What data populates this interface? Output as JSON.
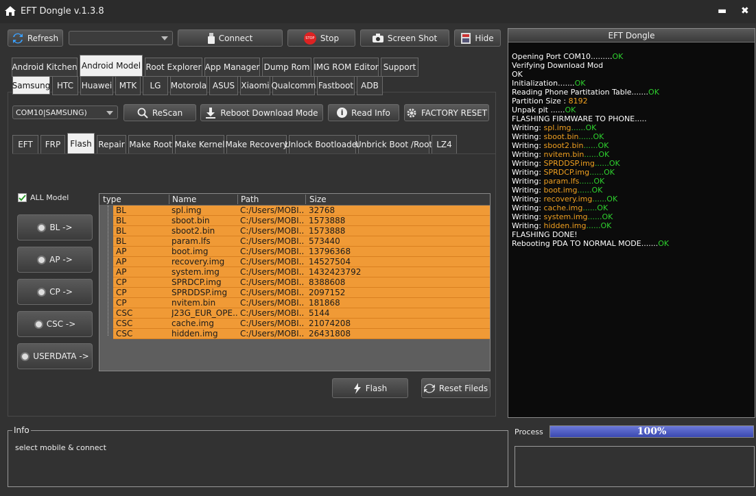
{
  "titlebar": {
    "title": "EFT Dongle  v.1.3.8",
    "minimize": "▬",
    "close": "✖"
  },
  "toolbar": {
    "refresh": "Refresh",
    "port_combo": "",
    "connect": "Connect",
    "stop": "Stop",
    "stop_badge": "STOP",
    "screenshot": "Screen Shot",
    "hide": "Hide"
  },
  "main_tabs": [
    "Android Kitchen",
    "Android Model",
    "Root Explorer",
    "App Manager",
    "Dump Rom",
    "IMG ROM Editor",
    "Support"
  ],
  "brand_tabs": [
    "Samsung",
    "HTC",
    "Huawei",
    "MTK",
    "LG",
    "Motorola",
    "ASUS",
    "Xiaomi",
    "Qualcomm",
    "Fastboot",
    "ADB"
  ],
  "device": {
    "port_select": "COM10|SAMSUNG)",
    "rescan": "ReScan",
    "reboot_download": "Reboot  Download Mode",
    "read_info": "Read Info",
    "factory_reset": "FACTORY RESET"
  },
  "func_tabs": [
    "EFT",
    "FRP",
    "Flash",
    "Repair",
    "Make Root",
    "Make Kernel",
    "Make Recovery",
    "Unlock Bootloader",
    "Unbrick Boot /Root",
    "LZ4"
  ],
  "all_model": "ALL Model",
  "side_buttons": [
    "BL ->",
    "AP ->",
    "CP ->",
    "CSC ->",
    "USERDATA ->"
  ],
  "grid": {
    "columns": [
      "type",
      "Name",
      "Path",
      "Size"
    ],
    "rows": [
      {
        "type": "BL",
        "name": "spl.img",
        "path": "C:/Users/MOBI...",
        "size": "32768"
      },
      {
        "type": "BL",
        "name": "sboot.bin",
        "path": "C:/Users/MOBI...",
        "size": "1573888"
      },
      {
        "type": "BL",
        "name": "sboot2.bin",
        "path": "C:/Users/MOBI...",
        "size": "1573888"
      },
      {
        "type": "BL",
        "name": "param.lfs",
        "path": "C:/Users/MOBI...",
        "size": "573440"
      },
      {
        "type": "AP",
        "name": "boot.img",
        "path": "C:/Users/MOBI...",
        "size": "13796368"
      },
      {
        "type": "AP",
        "name": "recovery.img",
        "path": "C:/Users/MOBI...",
        "size": "14527504"
      },
      {
        "type": "AP",
        "name": "system.img",
        "path": "C:/Users/MOBI...",
        "size": "1432423792"
      },
      {
        "type": "CP",
        "name": "SPRDCP.img",
        "path": "C:/Users/MOBI...",
        "size": "8388608"
      },
      {
        "type": "CP",
        "name": "SPRDDSP.img",
        "path": "C:/Users/MOBI...",
        "size": "2097152"
      },
      {
        "type": "CP",
        "name": "nvitem.bin",
        "path": "C:/Users/MOBI...",
        "size": "181868"
      },
      {
        "type": "CSC",
        "name": "J23G_EUR_OPE...",
        "path": "C:/Users/MOBI...",
        "size": "5144"
      },
      {
        "type": "CSC",
        "name": "cache.img",
        "path": "C:/Users/MOBI...",
        "size": "21074208"
      },
      {
        "type": "CSC",
        "name": "hidden.img",
        "path": "C:/Users/MOBI...",
        "size": "26431808"
      }
    ]
  },
  "actions": {
    "flash": "Flash",
    "reset": "Reset Fileds"
  },
  "log": {
    "title": "EFT Dongle",
    "lines": [
      {
        "text": "Opening Port COM10.........",
        "ok": "OK",
        "val": ""
      },
      {
        "text": "Verifying Download Mod",
        "ok": "",
        "val": ""
      },
      {
        "text": "OK",
        "ok": "",
        "val": ""
      },
      {
        "text": "Initialization.......",
        "ok": "OK",
        "val": ""
      },
      {
        "text": "Reading Phone Partitation Table.......",
        "ok": "OK",
        "val": ""
      },
      {
        "text": "Partition Size : ",
        "ok": "",
        "val": "8192"
      },
      {
        "text": "Unpak pit ......",
        "ok": "OK",
        "val": ""
      },
      {
        "text": "FLASHING FIRMWARE TO PHONE.....",
        "ok": "",
        "val": ""
      },
      {
        "text": "Writing: ",
        "val": "spl.img",
        "ok": "......OK"
      },
      {
        "text": "Writing: ",
        "val": "sboot.bin",
        "ok": "......OK"
      },
      {
        "text": "Writing: ",
        "val": "sboot2.bin",
        "ok": "......OK"
      },
      {
        "text": "Writing: ",
        "val": "nvitem.bin",
        "ok": "......OK"
      },
      {
        "text": "Writing: ",
        "val": "SPRDDSP.img",
        "ok": "......OK"
      },
      {
        "text": "Writing: ",
        "val": "SPRDCP.img",
        "ok": "......OK"
      },
      {
        "text": "Writing: ",
        "val": "param.lfs",
        "ok": "......OK"
      },
      {
        "text": "Writing: ",
        "val": "boot.img",
        "ok": "......OK"
      },
      {
        "text": "Writing: ",
        "val": "recovery.img",
        "ok": "......OK"
      },
      {
        "text": "Writing: ",
        "val": "cache.img",
        "ok": "......OK"
      },
      {
        "text": "Writing: ",
        "val": "system.img",
        "ok": "......OK"
      },
      {
        "text": "Writing: ",
        "val": "hidden.img",
        "ok": "......OK"
      },
      {
        "text": "FLASHING DONE!",
        "ok": "",
        "val": ""
      },
      {
        "text": "Rebooting PDA TO NORMAL MODE.......",
        "ok": "OK",
        "val": ""
      }
    ]
  },
  "info": {
    "legend": "Info",
    "message": "select mobile & connect"
  },
  "process": {
    "label": "Process",
    "percent_text": "100%",
    "fraction": 1.0
  }
}
